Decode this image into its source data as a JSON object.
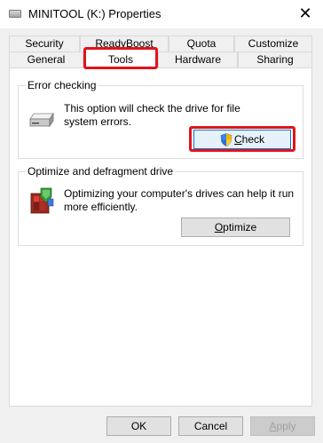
{
  "window": {
    "title": "MINITOOL (K:) Properties",
    "close_glyph": "✕"
  },
  "tabs": {
    "row1": [
      "Security",
      "ReadyBoost",
      "Quota",
      "Customize"
    ],
    "row2": [
      "General",
      "Tools",
      "Hardware",
      "Sharing"
    ],
    "active": "Tools"
  },
  "error_checking": {
    "group_label": "Error checking",
    "description_line1": "This option will check the drive for file",
    "description_line2": "system errors.",
    "icon": "drive-icon",
    "button_label_u": "C",
    "button_label_rest": "heck",
    "button_icon": "uac-shield-icon"
  },
  "optimize": {
    "group_label": "Optimize and defragment drive",
    "description_line1": "Optimizing your computer's drives can help it run",
    "description_line2": "more efficiently.",
    "icon": "defrag-icon",
    "button_label_u": "O",
    "button_label_rest": "ptimize"
  },
  "footer": {
    "ok_label": "OK",
    "cancel_label": "Cancel",
    "apply_label_u": "A",
    "apply_label_rest": "pply"
  },
  "colors": {
    "highlight": "#e0141c",
    "accent": "#0078d7",
    "dialog_bg": "#f0f0f0"
  }
}
